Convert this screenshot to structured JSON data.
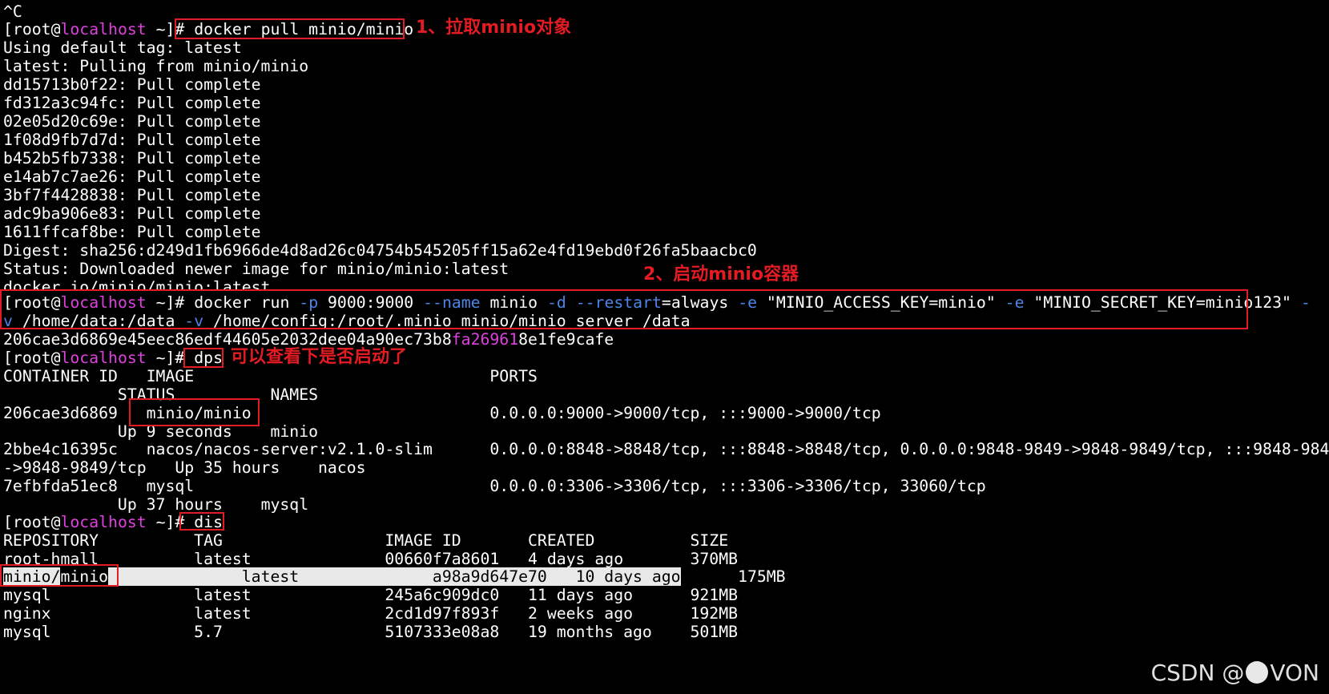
{
  "colors": {
    "background": "#000000",
    "text": "#ffffff",
    "hostname": "#e040e0",
    "option_flag": "#4b86e6",
    "annotation": "#e31b23"
  },
  "prompt": {
    "user": "root",
    "at": "@",
    "host": "localhost",
    "path": "~",
    "open": "[",
    "close": "]#"
  },
  "lines": {
    "ctrl_c": "^C",
    "cmd_pull": "docker pull minio/minio",
    "pull_out": [
      "Using default tag: latest",
      "latest: Pulling from minio/minio",
      "dd15713b0f22: Pull complete",
      "fd312a3c94fc: Pull complete",
      "02e05d20c69e: Pull complete",
      "1f08d9fb7d7d: Pull complete",
      "b452b5fb7338: Pull complete",
      "e14ab7c7ae26: Pull complete",
      "3bf7f4428838: Pull complete",
      "adc9ba906e83: Pull complete",
      "1611ffcaf8be: Pull complete",
      "Digest: sha256:d249d1fb6966de4d8ad26c04754b545205ff15a62e4fd19ebd0f26fa5baacbc0",
      "Status: Downloaded newer image for minio/minio:latest",
      "docker.io/minio/minio:latest"
    ],
    "run_cmd": {
      "p1": "docker run ",
      "f1": "-p",
      "p2": " 9000:9000 ",
      "f2": "--name",
      "p3": " minio ",
      "f3": "-d",
      "p4": " ",
      "f4": "--restart",
      "p5": "=always ",
      "f5": "-e",
      "p6": " \"MINIO_ACCESS_KEY=minio\" ",
      "f6": "-e",
      "p7": " \"MINIO_SECRET_KEY=minio123\" ",
      "f7": "-",
      "l2f1": "v",
      "l2p1": " /home/data:/data ",
      "l2f2": "-v",
      "l2p2": " /home/config:/root/.minio minio/minio server /data"
    },
    "container_hash": {
      "a": "206cae3d6869e45eec86edf44605e2032dee04a90ec73b8",
      "b": "fa26961",
      "c": "8e1fe9cafe"
    },
    "cmd_dps": "dps",
    "dps_out": [
      "CONTAINER ID   IMAGE                               PORTS",
      "      STATUS          NAMES",
      "206cae3d6869   minio/minio                         0.0.0.0:9000->9000/tcp, :::9000->9000/tcp",
      "      Up 9 seconds    minio",
      "2bbe4c16395c   nacos/nacos-server:v2.1.0-slim      0.0.0.0:8848->8848/tcp, :::8848->8848/tcp, 0.0.0.0:9848-9849->9848-9849/tcp, :::9848-9849",
      "->9848-9849/tcp   Up 35 hours    nacos",
      "7efbfda51ec8   mysql                               0.0.0.0:3306->3306/tcp, :::3306->3306/tcp, 33060/tcp",
      "      Up 37 hours    mysql"
    ],
    "cmd_dis": "dis",
    "dis_header": "REPOSITORY          TAG                 IMAGE ID       CREATED          SIZE",
    "dis_rows": [
      "root-hmall          latest              00660f7a8601   4 days ago       370MB",
      "mysql               latest              245a6c909dc0   11 days ago      921MB",
      "nginx               latest              2cd1d97f893f   2 weeks ago      192MB",
      "mysql               5.7                 5107333e08a8   19 months ago    501MB"
    ],
    "dis_sel": {
      "a": "minio/",
      "b": "minio",
      "c": "              latest              a98a9d647e70   10 days ago",
      "d": "      175MB"
    }
  },
  "annotations": {
    "pull": "1、拉取minio对象",
    "run": "2、启动minio容器",
    "dps": "可以查看下是否启动了"
  },
  "watermark": {
    "a": "CSDN @",
    "b": "VON"
  }
}
